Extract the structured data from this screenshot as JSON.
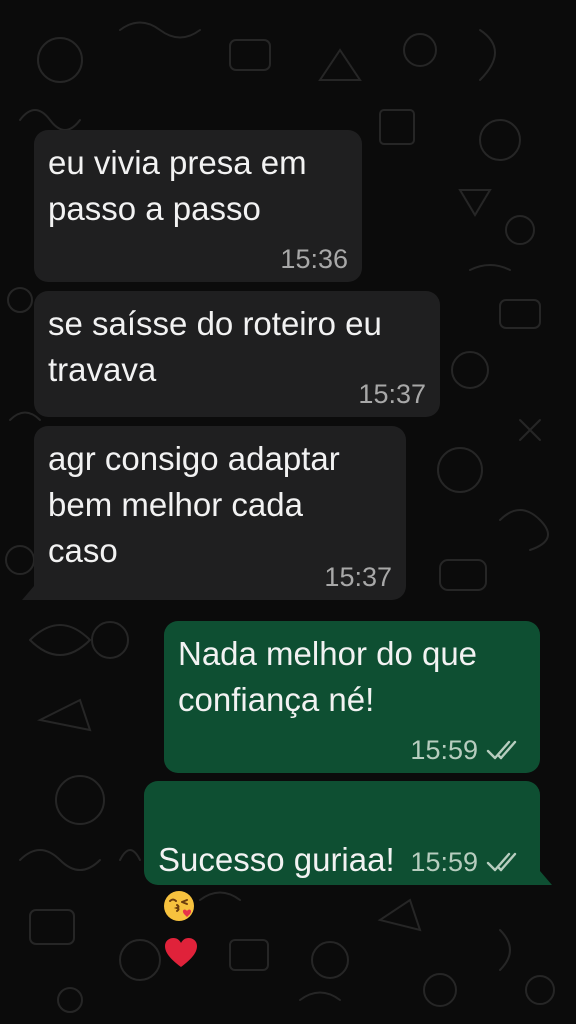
{
  "messages": [
    {
      "direction": "in",
      "text": "eu vivia presa em\npasso a passo",
      "time": "15:36"
    },
    {
      "direction": "in",
      "text": "se saísse do roteiro eu\ntravava",
      "time": "15:37"
    },
    {
      "direction": "in",
      "text": "agr consigo adaptar\nbem melhor cada\ncaso",
      "time": "15:37"
    },
    {
      "direction": "out",
      "text": "Nada melhor do que\nconfiança né!",
      "time": "15:59",
      "status_icon": "double-check-icon"
    },
    {
      "direction": "out",
      "text": "Sucesso guriaa!",
      "emojis": [
        "kissing-face-with-heart-emoji",
        "red-heart-emoji"
      ],
      "time": "15:59",
      "status_icon": "double-check-icon"
    }
  ],
  "colors": {
    "background": "#0b0b0b",
    "incoming_bubble": "#1f1f20",
    "outgoing_bubble": "#0e4f32",
    "text": "#f2f2f2",
    "time_incoming": "#a8a8a8",
    "time_outgoing": "#b7cdbf"
  }
}
